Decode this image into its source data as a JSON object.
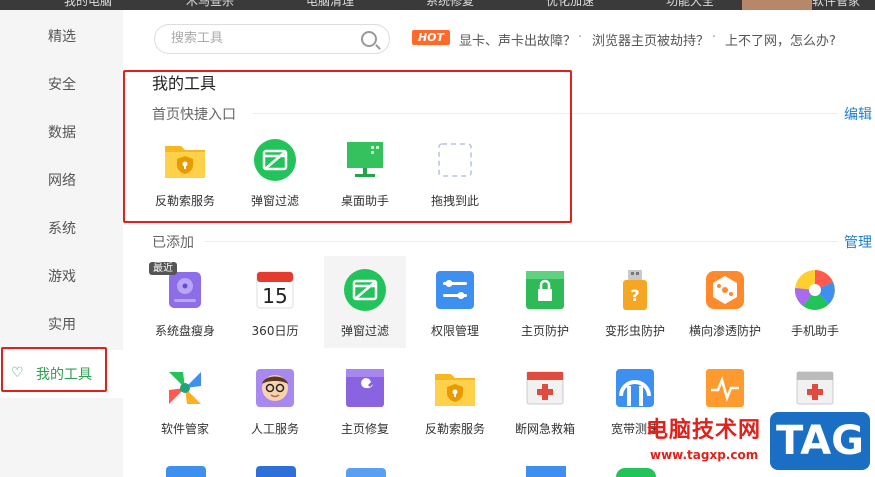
{
  "topnav": [
    "我的电脑",
    "木马查杀",
    "电脑清理",
    "系统修复",
    "优化加速",
    "功能大全",
    "软件管家"
  ],
  "sidebar": {
    "items": [
      {
        "label": "精选"
      },
      {
        "label": "安全"
      },
      {
        "label": "数据"
      },
      {
        "label": "网络"
      },
      {
        "label": "系统"
      },
      {
        "label": "游戏"
      },
      {
        "label": "实用"
      },
      {
        "label": "我的工具",
        "active": true
      }
    ]
  },
  "search": {
    "placeholder": "搜索工具"
  },
  "hot": {
    "badge": "HOT",
    "links": [
      "显卡、声卡出故障？",
      "浏览器主页被劫持？",
      "上不了网，怎么办?"
    ],
    "separator": "·"
  },
  "my_tools": {
    "title": "我的工具",
    "quick_entry_title": "首页快捷入口",
    "edit_label": "编辑",
    "quick_items": [
      {
        "label": "反勒索服务",
        "icon": "shield-folder-icon"
      },
      {
        "label": "弹窗过滤",
        "icon": "popup-filter-icon"
      },
      {
        "label": "桌面助手",
        "icon": "desktop-assistant-icon"
      },
      {
        "label": "拖拽到此",
        "icon": "drop-target-icon"
      }
    ]
  },
  "added": {
    "title": "已添加",
    "manage_label": "管理",
    "row1": [
      {
        "label": "系统盘瘦身",
        "icon": "disk-slim-icon",
        "badge": "最近"
      },
      {
        "label": "360日历",
        "icon": "calendar-icon",
        "day": "15"
      },
      {
        "label": "弹窗过滤",
        "icon": "popup-filter-icon"
      },
      {
        "label": "权限管理",
        "icon": "permission-icon"
      },
      {
        "label": "主页防护",
        "icon": "homepage-lock-icon"
      },
      {
        "label": "变形虫防护",
        "icon": "usb-shield-icon"
      },
      {
        "label": "横向渗透防护",
        "icon": "lateral-shield-icon"
      },
      {
        "label": "手机助手",
        "icon": "phone-assistant-icon"
      }
    ],
    "row2": [
      {
        "label": "软件管家",
        "icon": "software-manager-icon"
      },
      {
        "label": "人工服务",
        "icon": "human-service-icon"
      },
      {
        "label": "主页修复",
        "icon": "homepage-repair-icon"
      },
      {
        "label": "反勒索服务",
        "icon": "shield-folder-icon"
      },
      {
        "label": "断网急救箱",
        "icon": "network-firstaid-icon"
      },
      {
        "label": "宽带测速",
        "icon": "speed-test-icon"
      },
      {
        "label": "",
        "icon": "network-monitor-icon"
      },
      {
        "label": "",
        "icon": "firstaid-box-icon"
      }
    ]
  },
  "watermark": {
    "cn": "电脑技术网",
    "url": "www.tagxp.com",
    "tag": "TAG"
  },
  "colors": {
    "accent_green": "#2e9e4f",
    "link_blue": "#1a7fd4",
    "highlight_red": "#e0221b",
    "hot_orange": "#ff6a2b"
  }
}
